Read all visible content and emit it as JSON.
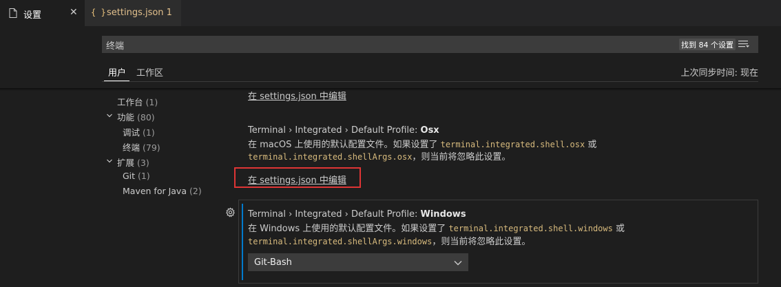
{
  "tabs": {
    "active": {
      "label": "设置",
      "close": "✕"
    },
    "inactive": {
      "braces": "{ }",
      "label": "settings.json 1"
    }
  },
  "search": {
    "value": "终端",
    "count": "找到 84 个设置"
  },
  "scopes": {
    "user": "用户",
    "workspace": "工作区",
    "sync_status": "上次同步时间: 现在"
  },
  "toc": {
    "items": [
      {
        "label": "工作台",
        "count": "(1)"
      },
      {
        "label": "功能",
        "count": "(80)"
      },
      {
        "label": "调试",
        "count": "(1)"
      },
      {
        "label": "终端",
        "count": "(79)"
      },
      {
        "label": "扩展",
        "count": "(3)"
      },
      {
        "label": "Git",
        "count": "(1)"
      },
      {
        "label": "Maven for Java",
        "count": "(2)"
      }
    ]
  },
  "content": {
    "edit_link": "在 settings.json 中编辑",
    "osx": {
      "title_prefix": "Terminal › Integrated › Default Profile: ",
      "title_name": "Osx",
      "desc_1": "在 macOS 上使用的默认配置文件。如果设置了 ",
      "code_1": "terminal.integrated.shell.osx",
      "desc_2": " 或",
      "code_2": "terminal.integrated.shellArgs.osx",
      "desc_3": "，则当前将忽略此设置。"
    },
    "windows": {
      "title_prefix": "Terminal › Integrated › Default Profile: ",
      "title_name": "Windows",
      "desc_1": "在 Windows 上使用的默认配置文件。如果设置了 ",
      "code_1": "terminal.integrated.shell.windows",
      "desc_2": " 或",
      "code_2": "terminal.integrated.shellArgs.windows",
      "desc_3": "，则当前将忽略此设置。",
      "selected": "Git-Bash"
    }
  },
  "colors": {
    "accent": "#007acc",
    "highlight": "#e03535",
    "code": "#d7ba7d"
  }
}
